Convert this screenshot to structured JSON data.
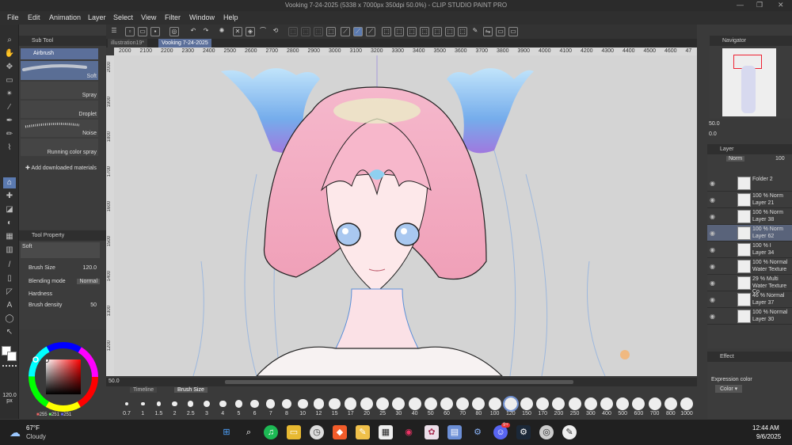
{
  "app": {
    "title": "Vooking 7-24-2025 (5338 x 7000px 350dpi 50.0%) - CLIP STUDIO PAINT PRO"
  },
  "menu": [
    "File",
    "Edit",
    "Animation",
    "Layer",
    "Select",
    "View",
    "Filter",
    "Window",
    "Help"
  ],
  "tabs": [
    "illustration19*",
    "Vooking 7-24-2025"
  ],
  "ruler_h": [
    "2000",
    "2100",
    "2200",
    "2300",
    "2400",
    "2500",
    "2600",
    "2700",
    "2800",
    "2900",
    "3000",
    "3100",
    "3200",
    "3300",
    "3400",
    "3500",
    "3600",
    "3700",
    "3800",
    "3900",
    "4000",
    "4100",
    "4200",
    "4300",
    "4400",
    "4500",
    "4600",
    "47"
  ],
  "ruler_v": [
    "2000",
    "1900",
    "1800",
    "1700",
    "1600",
    "1500",
    "1400",
    "1300",
    "1200"
  ],
  "subtool": {
    "header": "Sub Tool",
    "group": "Airbrush",
    "brushes": [
      "Soft",
      "Spray",
      "Droplet",
      "Noise",
      "Running color spray"
    ],
    "add": "Add downloaded materials"
  },
  "toolprop": {
    "header": "Tool Property",
    "brush": "Soft",
    "brush_size_label": "Brush Size",
    "brush_size": "120.0",
    "blend_label": "Blending mode",
    "blend_value": "Normal",
    "hardness_label": "Hardness",
    "density_label": "Brush density",
    "density": "50"
  },
  "color": {
    "main": "#ffffff",
    "sub": "#ffffff",
    "rgb": [
      "255",
      "251",
      "251"
    ]
  },
  "size_indicator": {
    "value": "120.0",
    "unit": "px"
  },
  "zoom": "50.0",
  "canvas_bottom": {
    "timeline": "Timeline",
    "brushsize": "Brush Size"
  },
  "brush_sizes": [
    "0.7",
    "1",
    "1.5",
    "2",
    "2.5",
    "3",
    "4",
    "5",
    "6",
    "7",
    "8",
    "10",
    "12",
    "15",
    "17",
    "20",
    "25",
    "30",
    "40",
    "50",
    "60",
    "70",
    "80",
    "100",
    "120",
    "150",
    "170",
    "200",
    "250",
    "300",
    "400",
    "500",
    "600",
    "700",
    "800",
    "1000"
  ],
  "brush_size_selected": "120",
  "navigator": {
    "header": "Navigator",
    "zoom": "50.0",
    "angle": "0.0"
  },
  "layer": {
    "header": "Layer",
    "blend": "Norm",
    "opacity": "100",
    "rows": [
      {
        "l1": "Folder 2",
        "l2": ""
      },
      {
        "l1": "100 % Norm",
        "l2": "Layer 21"
      },
      {
        "l1": "100 % Norm",
        "l2": "Layer 38"
      },
      {
        "l1": "100 % Norm",
        "l2": "Layer 62"
      },
      {
        "l1": "100 % I",
        "l2": "Layer 34"
      },
      {
        "l1": "100 % Normal",
        "l2": "Water Texture"
      },
      {
        "l1": "29 % Multi",
        "l2": "Water Texture Co"
      },
      {
        "l1": "46 % Normal",
        "l2": "Layer 37"
      },
      {
        "l1": "100 % Normal",
        "l2": "Layer 30"
      }
    ],
    "selected_index": 3
  },
  "effect": {
    "header": "Effect",
    "expression_label": "Expression color",
    "expression_value": "Color"
  },
  "taskbar": {
    "temp": "67°F",
    "weather": "Cloudy",
    "time": "12:44 AM",
    "date": "9/6/2025",
    "badge": "9+"
  }
}
